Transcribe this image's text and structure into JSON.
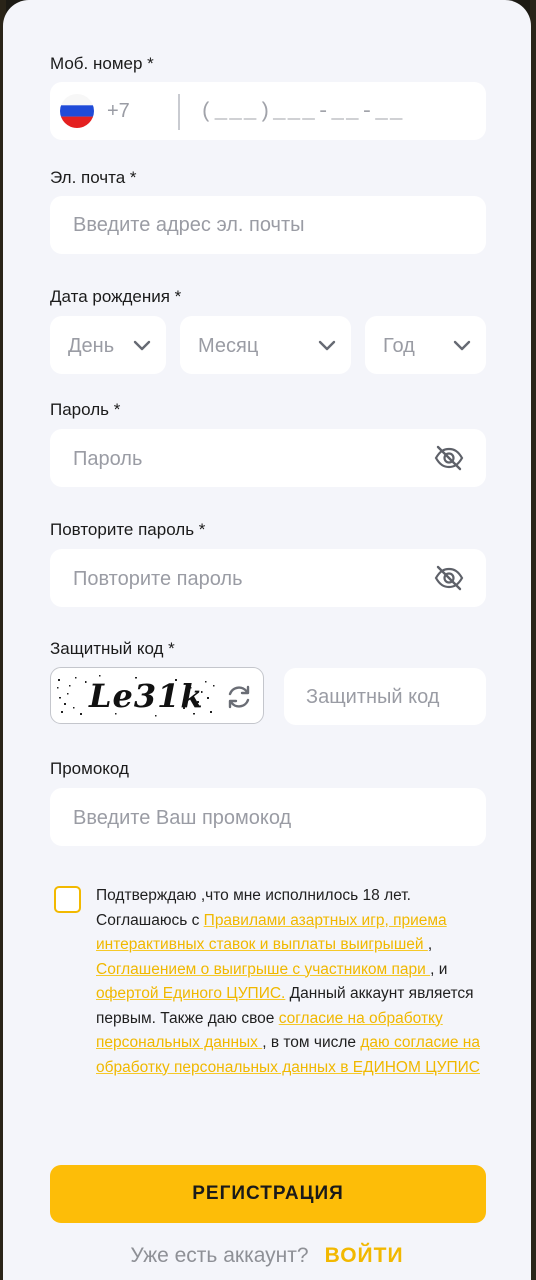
{
  "phone": {
    "label": "Моб. номер *",
    "country_code": "+7",
    "flag_icon": "russia-flag-icon",
    "placeholder": "(___)___-__-__"
  },
  "email": {
    "label": "Эл. почта *",
    "placeholder": "Введите адрес эл. почты"
  },
  "birth_date": {
    "label": "Дата рождения *",
    "day": "День",
    "month": "Месяц",
    "year": "Год"
  },
  "password": {
    "label": "Пароль *",
    "placeholder": "Пароль"
  },
  "password_repeat": {
    "label": "Повторите пароль *",
    "placeholder": "Повторите пароль"
  },
  "captcha": {
    "label": "Защитный код *",
    "image_text": "Le31k",
    "placeholder": "Защитный код"
  },
  "promo": {
    "label": "Промокод",
    "placeholder": "Введите Ваш промокод"
  },
  "terms": {
    "t1": "Подтверждаю ,что мне исполнилось 18 лет. Соглашаюсь с ",
    "link1": "Правилами азартных игр, приема интерактивных ставок и выплаты выигрышей ",
    "t2": ", ",
    "link2": "Соглашением о выигрыше с участником пари ",
    "t3": ", и ",
    "link3": "офертой Единого ЦУПИС.",
    "t4": " Данный аккаунт является первым. Также даю свое ",
    "link4": "согласие на обработку персональных данных ",
    "t5": ", в том числе ",
    "link5": "даю согласие на обработку персональных данных в ЕДИНОМ  ЦУПИС"
  },
  "register_button": "РЕГИСТРАЦИЯ",
  "login": {
    "question": "Уже есть аккаунт?",
    "action": "ВОЙТИ"
  },
  "colors": {
    "accent": "#fdbd08",
    "link": "#f0b800",
    "background": "#f4f5fa"
  }
}
